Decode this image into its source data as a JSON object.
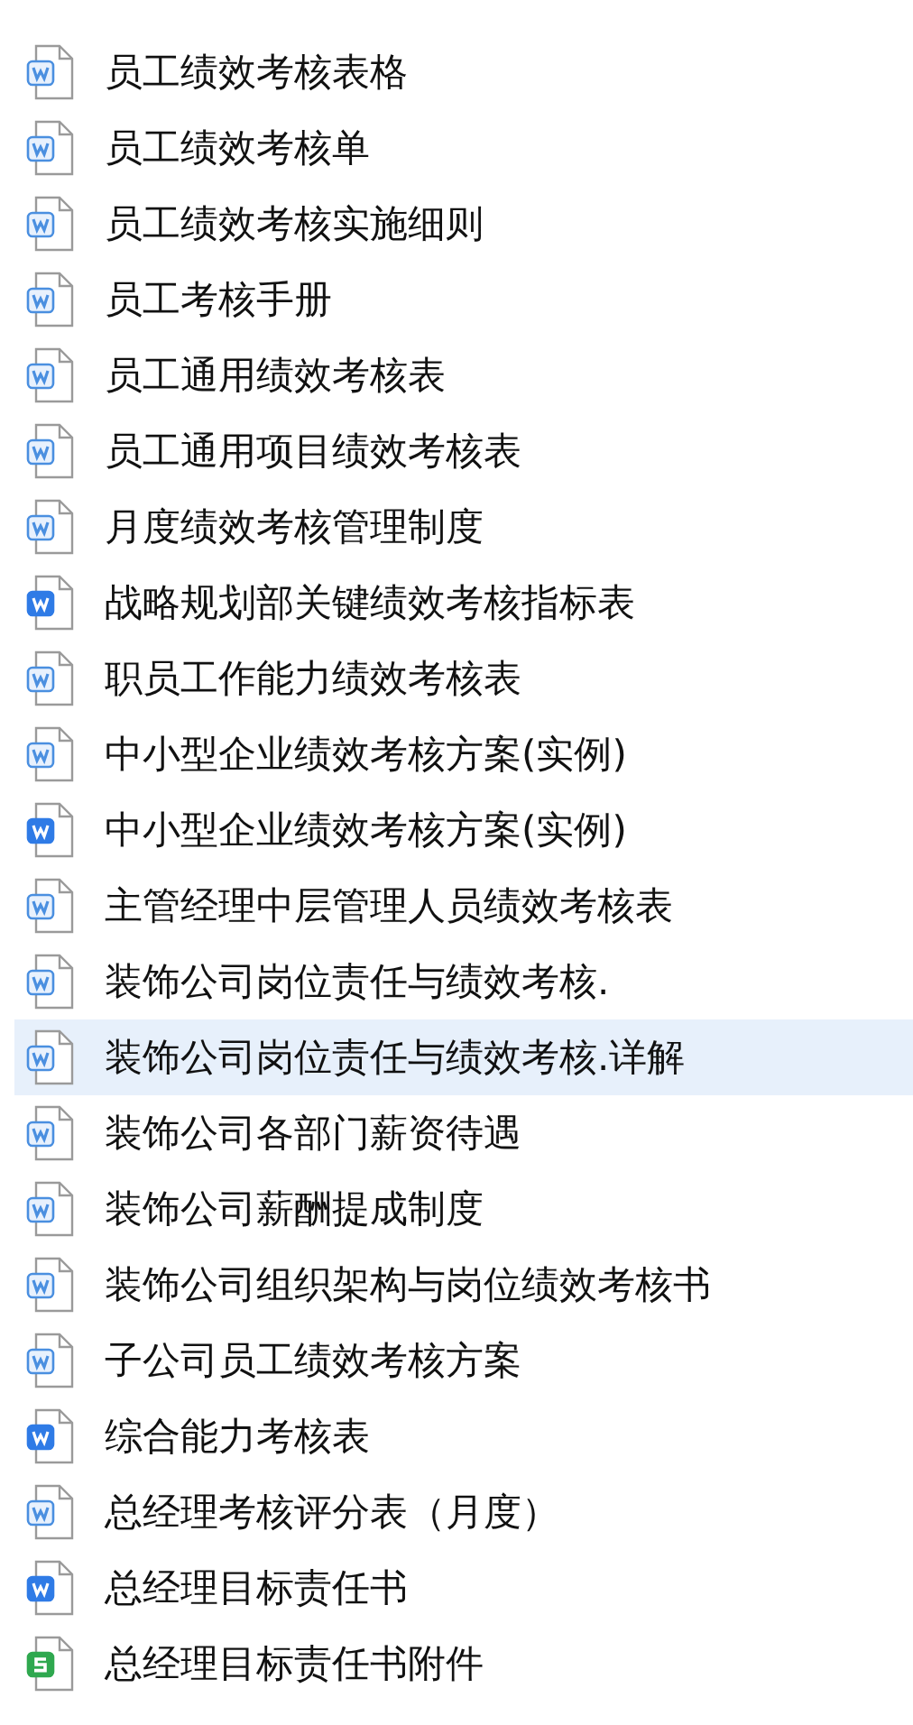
{
  "files": [
    {
      "name": "员工绩效考核表格",
      "kind": "doc",
      "selected": false
    },
    {
      "name": "员工绩效考核单",
      "kind": "doc",
      "selected": false
    },
    {
      "name": "员工绩效考核实施细则",
      "kind": "doc",
      "selected": false
    },
    {
      "name": "员工考核手册",
      "kind": "doc",
      "selected": false
    },
    {
      "name": "员工通用绩效考核表",
      "kind": "doc",
      "selected": false
    },
    {
      "name": "员工通用项目绩效考核表",
      "kind": "doc",
      "selected": false
    },
    {
      "name": "月度绩效考核管理制度",
      "kind": "doc",
      "selected": false
    },
    {
      "name": "战略规划部关键绩效考核指标表",
      "kind": "wps",
      "selected": false
    },
    {
      "name": "职员工作能力绩效考核表",
      "kind": "doc",
      "selected": false
    },
    {
      "name": "中小型企业绩效考核方案(实例)",
      "kind": "doc",
      "selected": false
    },
    {
      "name": "中小型企业绩效考核方案(实例)",
      "kind": "wps",
      "selected": false
    },
    {
      "name": "主管经理中层管理人员绩效考核表",
      "kind": "doc",
      "selected": false
    },
    {
      "name": "装饰公司岗位责任与绩效考核.",
      "kind": "doc",
      "selected": false
    },
    {
      "name": "装饰公司岗位责任与绩效考核.详解",
      "kind": "doc",
      "selected": true
    },
    {
      "name": "装饰公司各部门薪资待遇",
      "kind": "doc",
      "selected": false
    },
    {
      "name": "装饰公司薪酬提成制度",
      "kind": "doc",
      "selected": false
    },
    {
      "name": "装饰公司组织架构与岗位绩效考核书",
      "kind": "doc",
      "selected": false
    },
    {
      "name": "子公司员工绩效考核方案",
      "kind": "doc",
      "selected": false
    },
    {
      "name": "综合能力考核表",
      "kind": "wps",
      "selected": false
    },
    {
      "name": "总经理考核评分表（月度）",
      "kind": "doc",
      "selected": false
    },
    {
      "name": "总经理目标责任书",
      "kind": "wps",
      "selected": false
    },
    {
      "name": "总经理目标责任书附件",
      "kind": "sheet",
      "selected": false
    }
  ]
}
